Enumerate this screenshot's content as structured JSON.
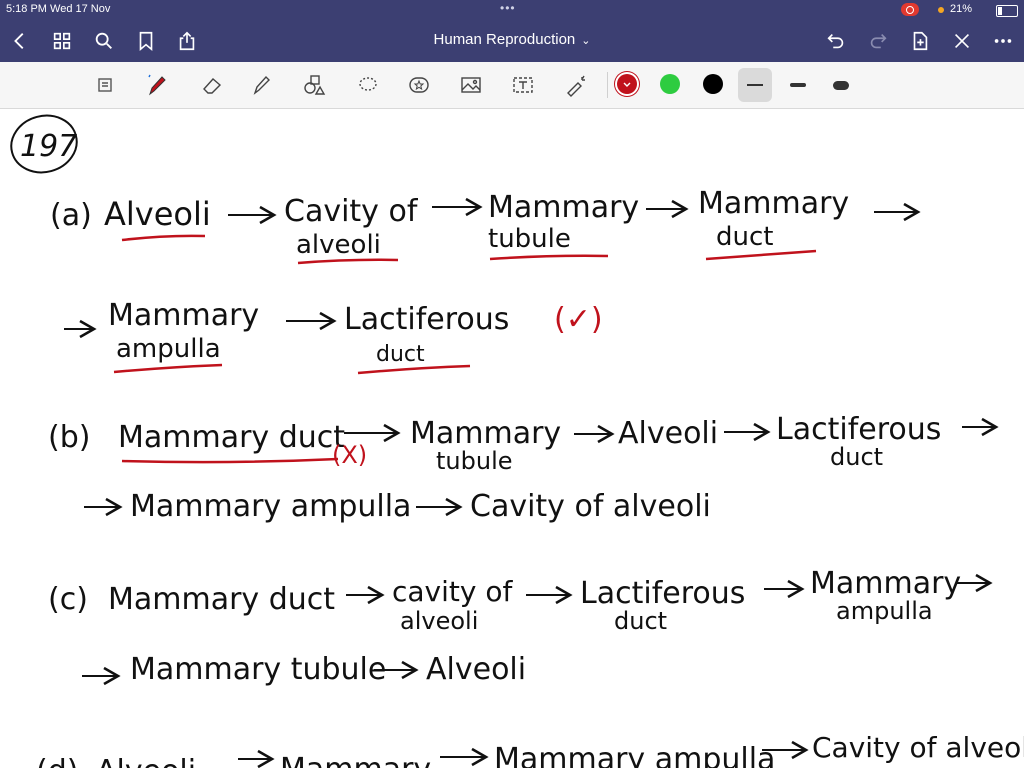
{
  "status": {
    "time_date": "5:18 PM   Wed 17 Nov",
    "dots": "•••",
    "battery": "21%"
  },
  "nav": {
    "title": "Human Reproduction",
    "title_chevron": "⌄"
  },
  "toolbar": {
    "colors": [
      "#c0121c",
      "#2ecc40",
      "#000000"
    ],
    "selected_color": "#c0121c"
  },
  "notes": {
    "question_number": "197",
    "a": {
      "label": "(a)",
      "w1": "Alveoli",
      "w2a": "Cavity of",
      "w2b": "alveoli",
      "w3a": "Mammary",
      "w3b": "tubule",
      "w4a": "Mammary",
      "w4b": "duct",
      "w5a": "Mammary",
      "w5b": "ampulla",
      "w6": "Lactiferous",
      "w6b": "duct",
      "mark": "(✓)"
    },
    "b": {
      "label": "(b)",
      "w1": "Mammary duct",
      "mark": "(X)",
      "w2a": "Mammary",
      "w2b": "tubule",
      "w3": "Alveoli",
      "w4a": "Lactiferous",
      "w4b": "duct",
      "w5": "Mammary ampulla",
      "w6": "Cavity of alveoli"
    },
    "c": {
      "label": "(c)",
      "w1": "Mammary duct",
      "w2a": "cavity of",
      "w2b": "alveoli",
      "w3a": "Lactiferous",
      "w3b": "duct",
      "w4a": "Mammary",
      "w4b": "ampulla",
      "w5": "Mammary tubule",
      "w6": "Alveoli"
    },
    "d": {
      "label": "(d)",
      "w1": "Alveoli",
      "w2": "Mammary",
      "w3": "Mammary ampulla",
      "w4": "Cavity of alveoli"
    },
    "arrow": "→"
  }
}
